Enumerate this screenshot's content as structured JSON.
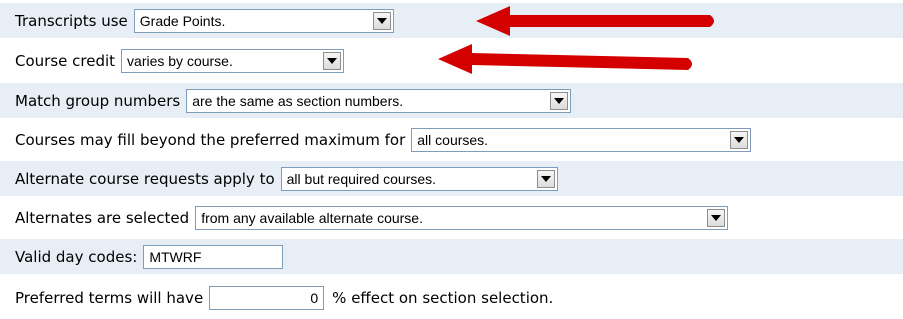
{
  "rows": [
    {
      "label": "Transcripts use",
      "value": "Grade Points."
    },
    {
      "label": "Course credit",
      "value": "varies by course."
    },
    {
      "label": "Match group numbers",
      "value": "are the same as section numbers."
    },
    {
      "label": "Courses may fill beyond the preferred maximum for",
      "value": "all courses."
    },
    {
      "label": "Alternate course requests apply to",
      "value": "all but required courses."
    },
    {
      "label": "Alternates are selected",
      "value": "from any available alternate course."
    },
    {
      "label": "Valid day codes:",
      "value": "MTWRF"
    },
    {
      "label": "Preferred terms will have",
      "value": "0",
      "suffix": "% effect on section selection."
    }
  ],
  "colors": {
    "row_alt": "#e8eef5",
    "arrow": "#d40000",
    "border": "#7f9db9"
  },
  "icons": {
    "dropdown": "chevron-down-icon",
    "annotation": "red-arrow-icon"
  }
}
